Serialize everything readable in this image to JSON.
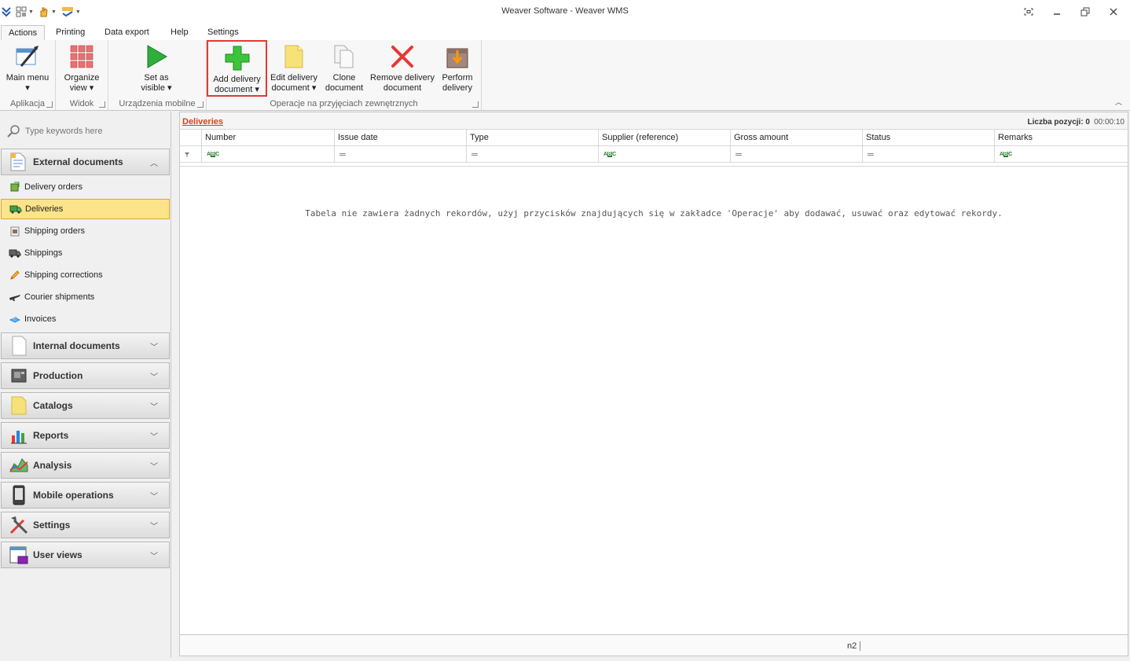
{
  "window": {
    "title": "Weaver Software - Weaver WMS"
  },
  "quick_access": [
    {
      "icon": "layout-icon"
    },
    {
      "icon": "hand-icon"
    },
    {
      "icon": "spellcheck-icon"
    }
  ],
  "tabs": [
    {
      "label": "Actions",
      "active": true
    },
    {
      "label": "Printing",
      "active": false
    },
    {
      "label": "Data export",
      "active": false
    },
    {
      "label": "Help",
      "active": false
    },
    {
      "label": "Settings",
      "active": false
    }
  ],
  "ribbon": {
    "groups": [
      {
        "label": "Aplikacja",
        "buttons": [
          {
            "line1": "Main menu",
            "line2": "▾"
          }
        ]
      },
      {
        "label": "Widok",
        "buttons": [
          {
            "line1": "Organize",
            "line2": "view ▾"
          }
        ]
      },
      {
        "label": "Urządzenia mobilne",
        "buttons": [
          {
            "line1": "Set as",
            "line2": "visible ▾"
          }
        ]
      },
      {
        "label": "Operacje na przyjęciach zewnętrznych",
        "buttons": [
          {
            "line1": "Add delivery",
            "line2": "document ▾"
          },
          {
            "line1": "Edit delivery",
            "line2": "document ▾"
          },
          {
            "line1": "Clone",
            "line2": "document"
          },
          {
            "line1": "Remove delivery",
            "line2": "document"
          },
          {
            "line1": "Perform",
            "line2": "delivery"
          }
        ]
      }
    ]
  },
  "sidebar": {
    "search_placeholder": "Type keywords here",
    "expanded_group": {
      "title": "External documents",
      "items": [
        {
          "label": "Delivery orders"
        },
        {
          "label": "Deliveries",
          "selected": true
        },
        {
          "label": "Shipping orders"
        },
        {
          "label": "Shippings"
        },
        {
          "label": "Shipping corrections"
        },
        {
          "label": "Courier shipments"
        },
        {
          "label": "Invoices"
        }
      ]
    },
    "collapsed_groups": [
      {
        "title": "Internal documents"
      },
      {
        "title": "Production"
      },
      {
        "title": "Catalogs"
      },
      {
        "title": "Reports"
      },
      {
        "title": "Analysis"
      },
      {
        "title": "Mobile operations"
      },
      {
        "title": "Settings"
      },
      {
        "title": "User views"
      }
    ]
  },
  "content": {
    "view_title": "Deliveries",
    "count_label": "Liczba pozycji: 0",
    "time": "00:00:10",
    "columns": [
      {
        "label": "Number",
        "filter": "abc"
      },
      {
        "label": "Issue date",
        "filter": "eq"
      },
      {
        "label": "Type",
        "filter": "eq"
      },
      {
        "label": "Supplier (reference)",
        "filter": "abc"
      },
      {
        "label": "Gross amount",
        "filter": "eq"
      },
      {
        "label": "Status",
        "filter": "eq"
      },
      {
        "label": "Remarks",
        "filter": "abc"
      }
    ],
    "empty_message": "Tabela nie zawiera żadnych rekordów, użyj przycisków znajdujących się w zakładce 'Operacje' aby dodawać, usuwać oraz edytować rekordy.",
    "footer_value": "n2"
  },
  "colors": {
    "accent_title": "#d84315",
    "selected_bg": "#fde38a",
    "highlight_border": "#e53935"
  }
}
